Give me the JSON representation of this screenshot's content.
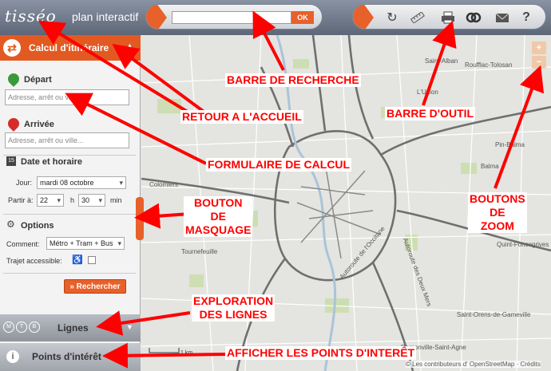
{
  "header": {
    "logo": "tisséo",
    "subtitle": "plan interactif",
    "ok_label": "OK",
    "tools": [
      "refresh-icon",
      "ruler-icon",
      "print-icon",
      "link-icon",
      "mail-icon",
      "help-icon"
    ]
  },
  "sidebar": {
    "calc_title": "Calcul d'itinéraire",
    "depart_label": "Départ",
    "depart_placeholder": "Adresse, arrêt ou ville...",
    "arrivee_label": "Arrivée",
    "arrivee_placeholder": "Adresse, arrêt ou ville...",
    "date_section": "Date et horaire",
    "jour_label": "Jour:",
    "jour_value": "mardi 08 octobre",
    "partir_label": "Partir à:",
    "hour_value": "22",
    "h_label": "h",
    "min_value": "30",
    "min_label": "min",
    "options_section": "Options",
    "comment_label": "Comment:",
    "comment_value": "Métro + Tram + Bus",
    "trajet_label": "Trajet accessible:",
    "search_button": "» Rechercher",
    "lignes_label": "Lignes",
    "lignes_modes": [
      "M",
      "T",
      "B"
    ],
    "poi_label": "Points d'intérêt"
  },
  "map": {
    "places": [
      "Saint-Alban",
      "Roufflac-Tolosan",
      "L'Union",
      "Pin-Balma",
      "Balma",
      "Colomiers",
      "Tournefeuille",
      "Quint-Fonsegrives",
      "Saint-Orens-de-Gameville",
      "Ramonville-Saint-Agne",
      "Autoroute des Deux Mers",
      "Autoroute de l'Occitane"
    ],
    "credits": "© Les contributeurs d' OpenStreetMap · Crédits",
    "scale": "1 km"
  },
  "annotations": {
    "search": "BARRE DE RECHERCHE",
    "home": "RETOUR A L'ACCUEIL",
    "toolbar": "BARRE D'OUTIL",
    "form": "FORMULAIRE DE CALCUL",
    "mask": "BOUTON\nDE\nMASQUAGE",
    "zoom": "BOUTONS\nDE\nZOOM",
    "lines": "EXPLORATION\nDES LIGNES",
    "poi": "AFFICHER LES POINTS D'INTERÊT"
  },
  "colors": {
    "accent": "#e25a22",
    "annotation": "#ff0000",
    "major_road": "#777777"
  }
}
